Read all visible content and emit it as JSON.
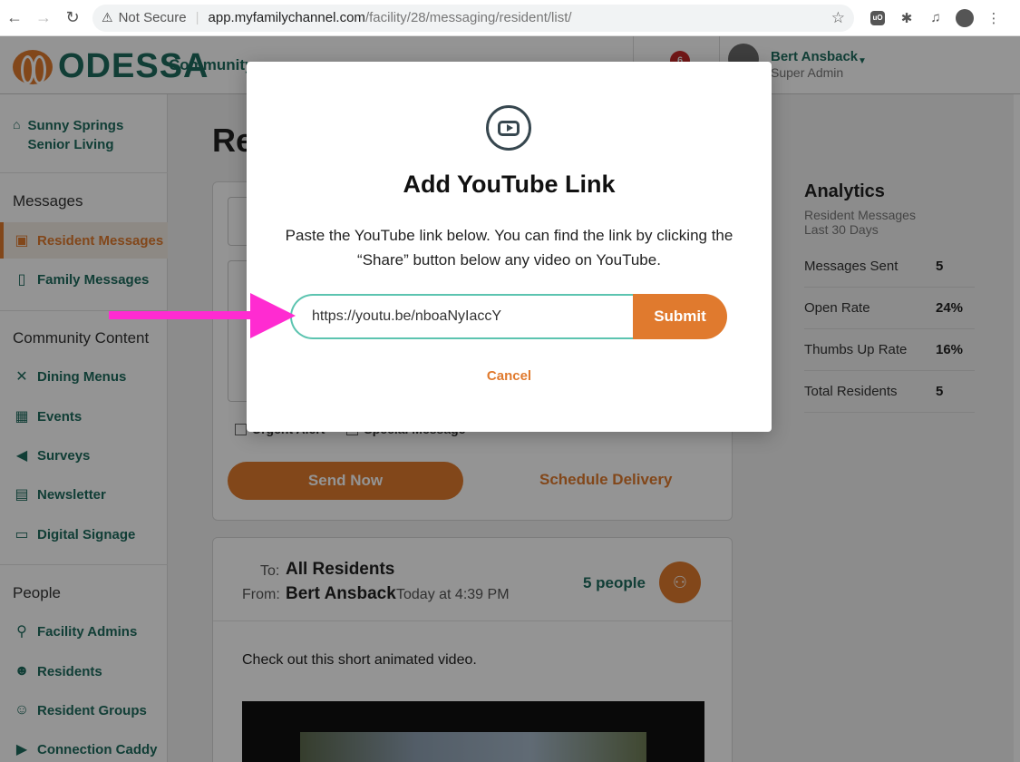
{
  "browser": {
    "security_label": "Not Secure",
    "url_host": "app.myfamilychannel.com",
    "url_path": "/facility/28/messaging/resident/list/"
  },
  "header": {
    "logo_text": "ODESSA",
    "community_label": "Community",
    "notification_count": "6",
    "user_name": "Bert Ansback",
    "user_role": "Super Admin"
  },
  "sidebar": {
    "facility_name": "Sunny Springs Senior Living",
    "sections": {
      "messages": "Messages",
      "community": "Community Content",
      "people": "People"
    },
    "items": [
      {
        "label": "Resident Messages",
        "icon": "tv-icon",
        "active": true
      },
      {
        "label": "Family Messages",
        "icon": "tablet-icon"
      },
      {
        "label": "Dining Menus",
        "icon": "utensils-icon"
      },
      {
        "label": "Events",
        "icon": "calendar-icon"
      },
      {
        "label": "Surveys",
        "icon": "megaphone-icon"
      },
      {
        "label": "Newsletter",
        "icon": "newspaper-icon"
      },
      {
        "label": "Digital Signage",
        "icon": "monitor-icon"
      },
      {
        "label": "Facility Admins",
        "icon": "lock-icon"
      },
      {
        "label": "Residents",
        "icon": "user-icon"
      },
      {
        "label": "Resident Groups",
        "icon": "users-icon"
      },
      {
        "label": "Connection Caddy",
        "icon": "video-icon"
      }
    ]
  },
  "main": {
    "title_partial": "Re",
    "compose": {
      "urgent_label": "Urgent Alert",
      "special_label": "Special Message",
      "send_label": "Send Now",
      "schedule_label": "Schedule Delivery"
    },
    "message": {
      "to_label": "To:",
      "to_value": "All Residents",
      "from_label": "From:",
      "from_value": "Bert Ansback",
      "time": "Today at 4:39 PM",
      "people_count": "5 people",
      "body": "Check out this short animated video."
    }
  },
  "analytics": {
    "title": "Analytics",
    "subtitle_line1": "Resident Messages",
    "subtitle_line2": "Last 30 Days",
    "stats": [
      {
        "label": "Messages Sent",
        "value": "5"
      },
      {
        "label": "Open Rate",
        "value": "24%"
      },
      {
        "label": "Thumbs Up Rate",
        "value": "16%"
      },
      {
        "label": "Total Residents",
        "value": "5"
      }
    ]
  },
  "modal": {
    "icon": "youtube-icon",
    "title": "Add YouTube Link",
    "description": "Paste the YouTube link below. You can find the link by clicking the “Share” button below any video on YouTube.",
    "input_value": "https://youtu.be/nboaNyIaccY",
    "submit_label": "Submit",
    "cancel_label": "Cancel"
  },
  "colors": {
    "brand_green": "#1e6b5e",
    "brand_orange": "#e07a2e",
    "annotation_arrow": "#ff2bd1"
  }
}
